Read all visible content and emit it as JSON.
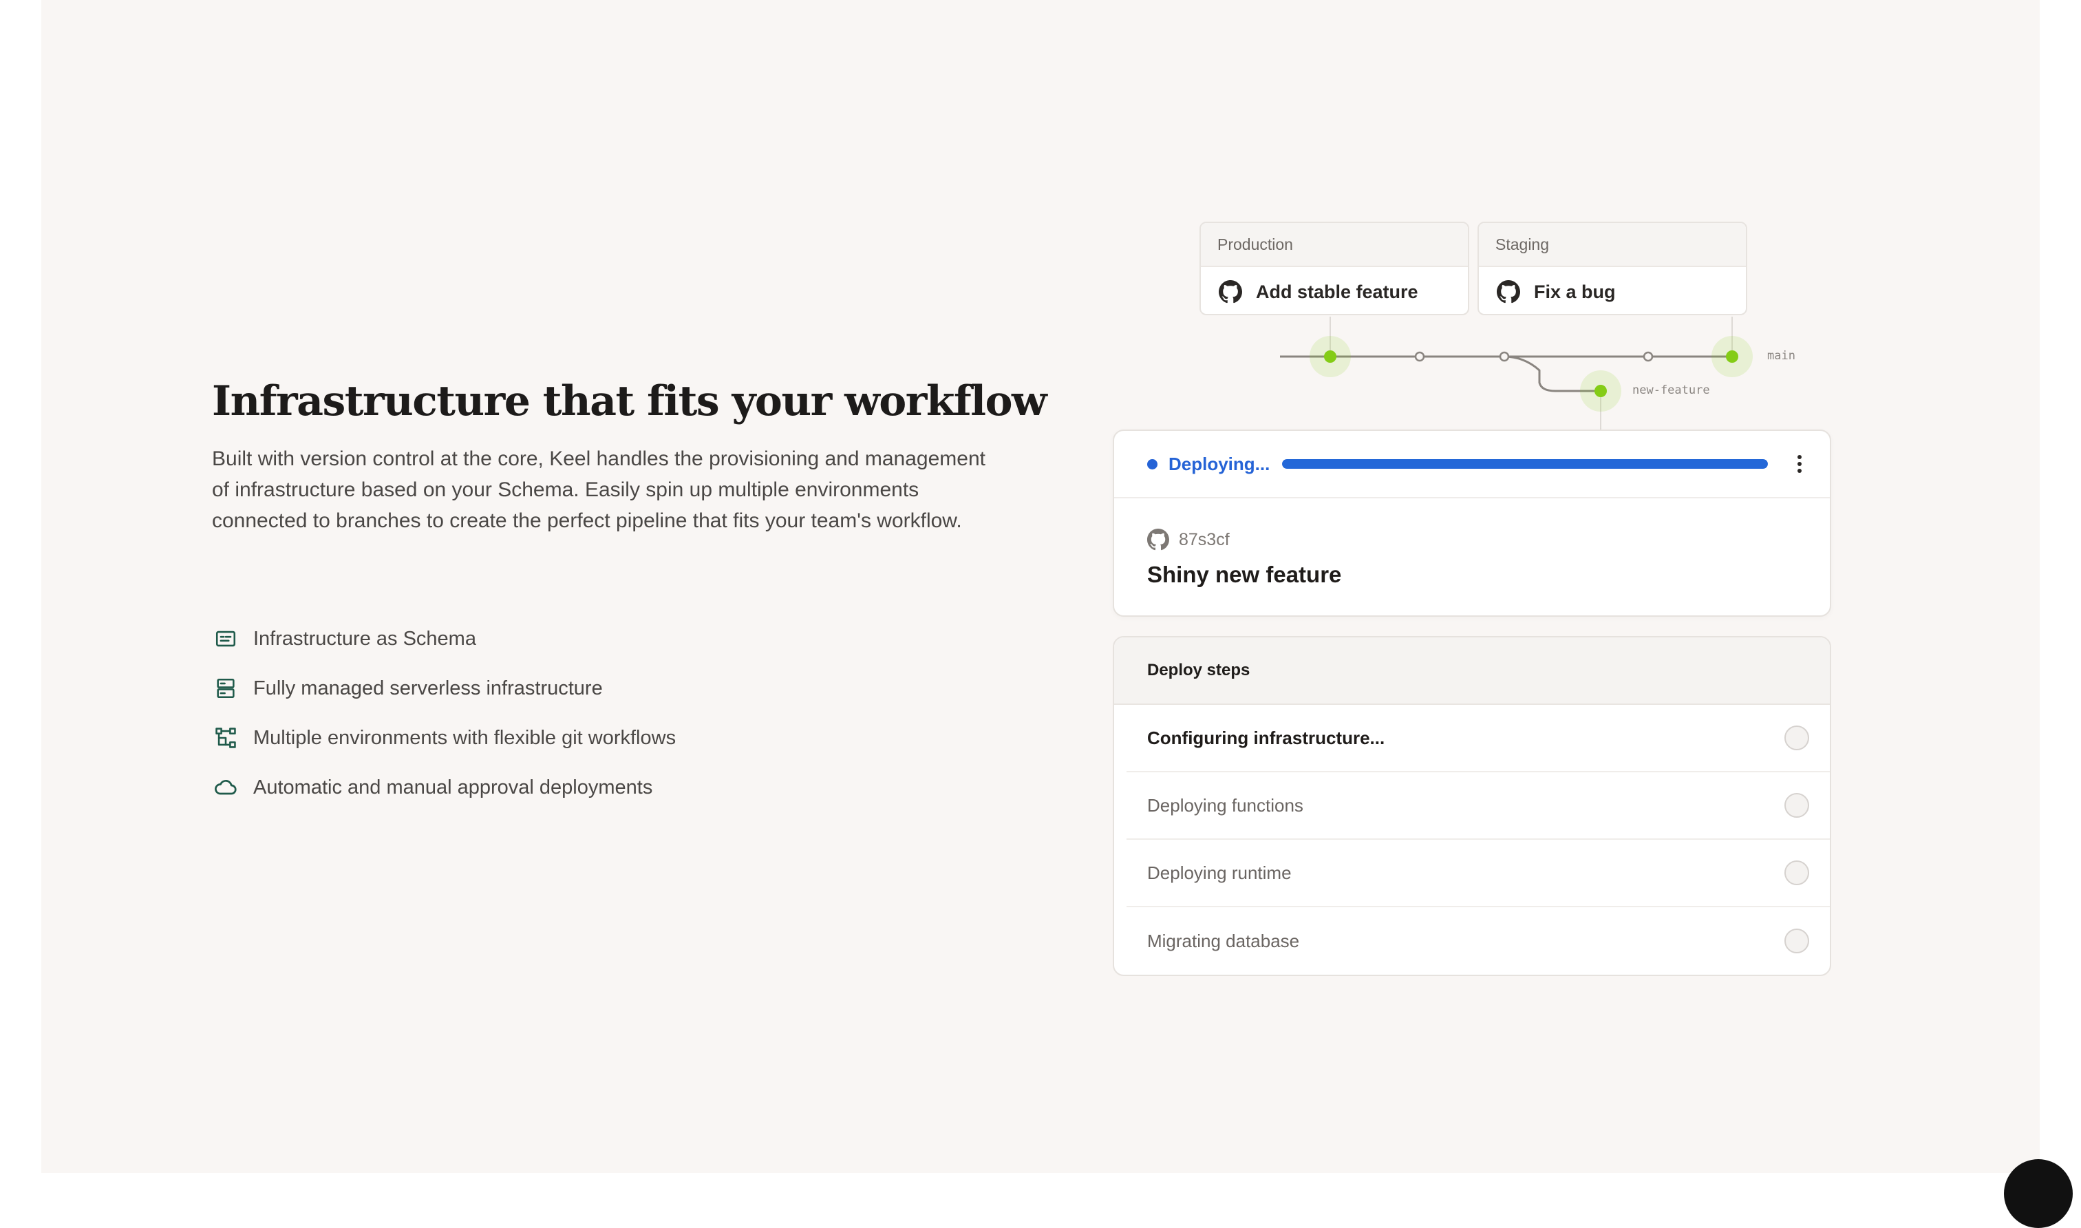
{
  "hero": {
    "title": "Infrastructure that fits your workflow",
    "description": "Built with version control at the core, Keel handles the provisioning and management of infrastructure based on your Schema. Easily spin up multiple environments connected to branches to create the perfect pipeline that fits your team's workflow."
  },
  "features": [
    {
      "icon": "schema-icon",
      "label": "Infrastructure as Schema"
    },
    {
      "icon": "server-icon",
      "label": "Fully managed serverless infrastructure"
    },
    {
      "icon": "git-branches-icon",
      "label": "Multiple environments with flexible git workflows"
    },
    {
      "icon": "cloud-icon",
      "label": "Automatic and manual approval deployments"
    }
  ],
  "environments": [
    {
      "name": "Production",
      "commit": "Add stable feature"
    },
    {
      "name": "Staging",
      "commit": "Fix a bug"
    }
  ],
  "branches": {
    "main": "main",
    "feature": "new-feature"
  },
  "deploy": {
    "status": "Deploying...",
    "progress": 1.0,
    "commit_hash": "87s3cf",
    "commit_title": "Shiny new feature"
  },
  "steps": {
    "title": "Deploy steps",
    "items": [
      {
        "label": "Configuring infrastructure...",
        "state": "active"
      },
      {
        "label": "Deploying functions",
        "state": "pending"
      },
      {
        "label": "Deploying runtime",
        "state": "pending"
      },
      {
        "label": "Migrating database",
        "state": "pending"
      }
    ]
  },
  "colors": {
    "accent_green": "#84cc16",
    "accent_blue": "#2563d6",
    "icon_green": "#1f5a4a",
    "background": "#f9f6f4"
  }
}
